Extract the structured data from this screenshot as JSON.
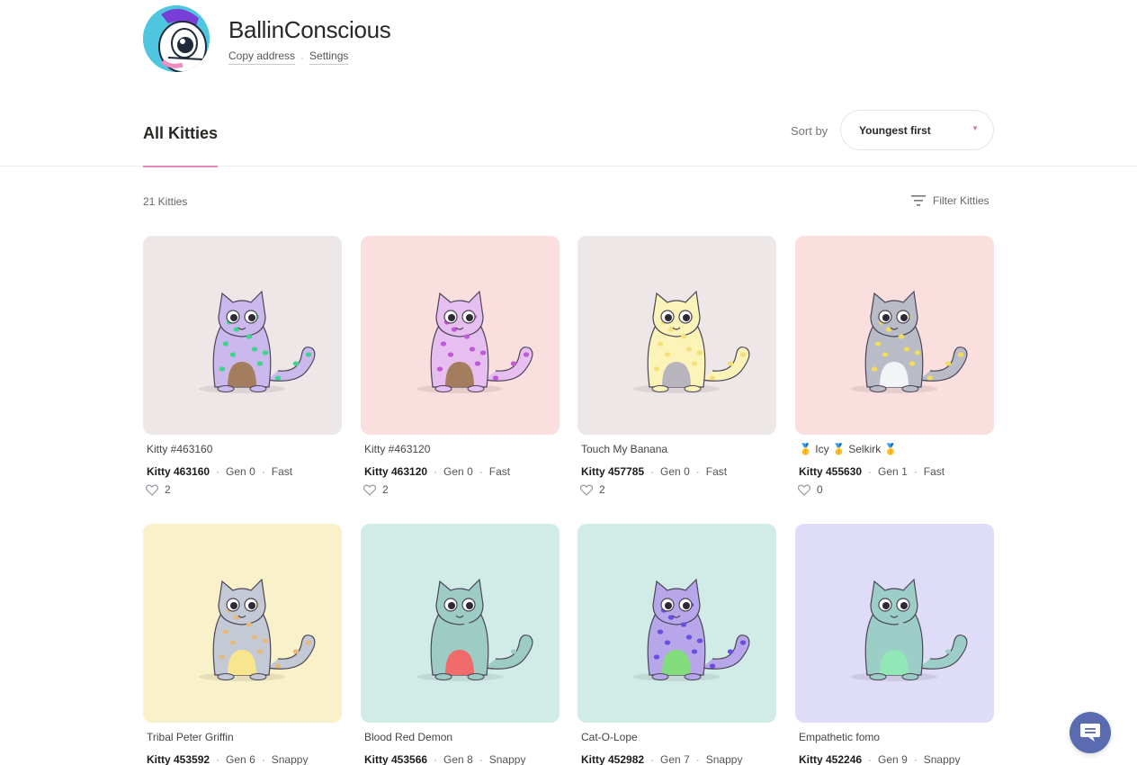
{
  "profile": {
    "username": "BallinConscious",
    "copy_address": "Copy address",
    "settings": "Settings",
    "separator": "·"
  },
  "tabs": {
    "all_kitties": "All Kitties"
  },
  "sort": {
    "label": "Sort by",
    "selected": "Youngest first"
  },
  "list": {
    "count": "21 Kitties",
    "filter_label": "Filter Kitties"
  },
  "kitties": [
    {
      "name": "Kitty #463160",
      "id": "Kitty 463160",
      "gen": "Gen 0",
      "speed": "Fast",
      "likes": "2",
      "bg": "#ede7e7",
      "body": "#cbb9ee",
      "spot": "#3fd48a",
      "belly": "#a47c5e"
    },
    {
      "name": "Kitty #463120",
      "id": "Kitty 463120",
      "gen": "Gen 0",
      "speed": "Fast",
      "likes": "2",
      "bg": "#fbdede",
      "body": "#e6bff0",
      "spot": "#c05ad6",
      "belly": "#a47c5e"
    },
    {
      "name": "Touch My Banana",
      "id": "Kitty 457785",
      "gen": "Gen 0",
      "speed": "Fast",
      "likes": "2",
      "bg": "#ede7e7",
      "body": "#fbf3b8",
      "spot": "#f3e07a",
      "belly": "#b8b5bf"
    },
    {
      "name": "🥇 Icy 🥇 Selkirk 🥇",
      "id": "Kitty 455630",
      "gen": "Gen 1",
      "speed": "Fast",
      "likes": "0",
      "bg": "#fbdede",
      "body": "#b9bcc6",
      "spot": "#f1dc5c",
      "belly": "#f1f5f8"
    },
    {
      "name": "Tribal Peter Griffin",
      "id": "Kitty 453592",
      "gen": "Gen 6",
      "speed": "Snappy",
      "likes": "",
      "bg": "#f9f1c9",
      "body": "#c4c9d6",
      "spot": "#e8b87a",
      "belly": "#f8e68e"
    },
    {
      "name": "Blood Red Demon",
      "id": "Kitty 453566",
      "gen": "Gen 8",
      "speed": "Snappy",
      "likes": "",
      "bg": "#d1ece7",
      "body": "#9cccc4",
      "spot": "#9cccc4",
      "belly": "#f26b6b"
    },
    {
      "name": "Cat-O-Lope",
      "id": "Kitty 452982",
      "gen": "Gen 7",
      "speed": "Snappy",
      "likes": "",
      "bg": "#d1ece7",
      "body": "#b7a7ea",
      "spot": "#6a4ee0",
      "belly": "#84dd7c"
    },
    {
      "name": "Empathetic fomo",
      "id": "Kitty 452246",
      "gen": "Gen 9",
      "speed": "Snappy",
      "likes": "",
      "bg": "#dedcf7",
      "body": "#9ccdc6",
      "spot": "#9ccdc6",
      "belly": "#92e7b6"
    }
  ],
  "icons": {
    "heart": "heart-icon",
    "filter": "filter-icon",
    "chat": "chat-icon",
    "caret": "▼"
  },
  "colors": {
    "accent_pink": "#e887b5",
    "chat_blue": "#5a6bb0"
  }
}
